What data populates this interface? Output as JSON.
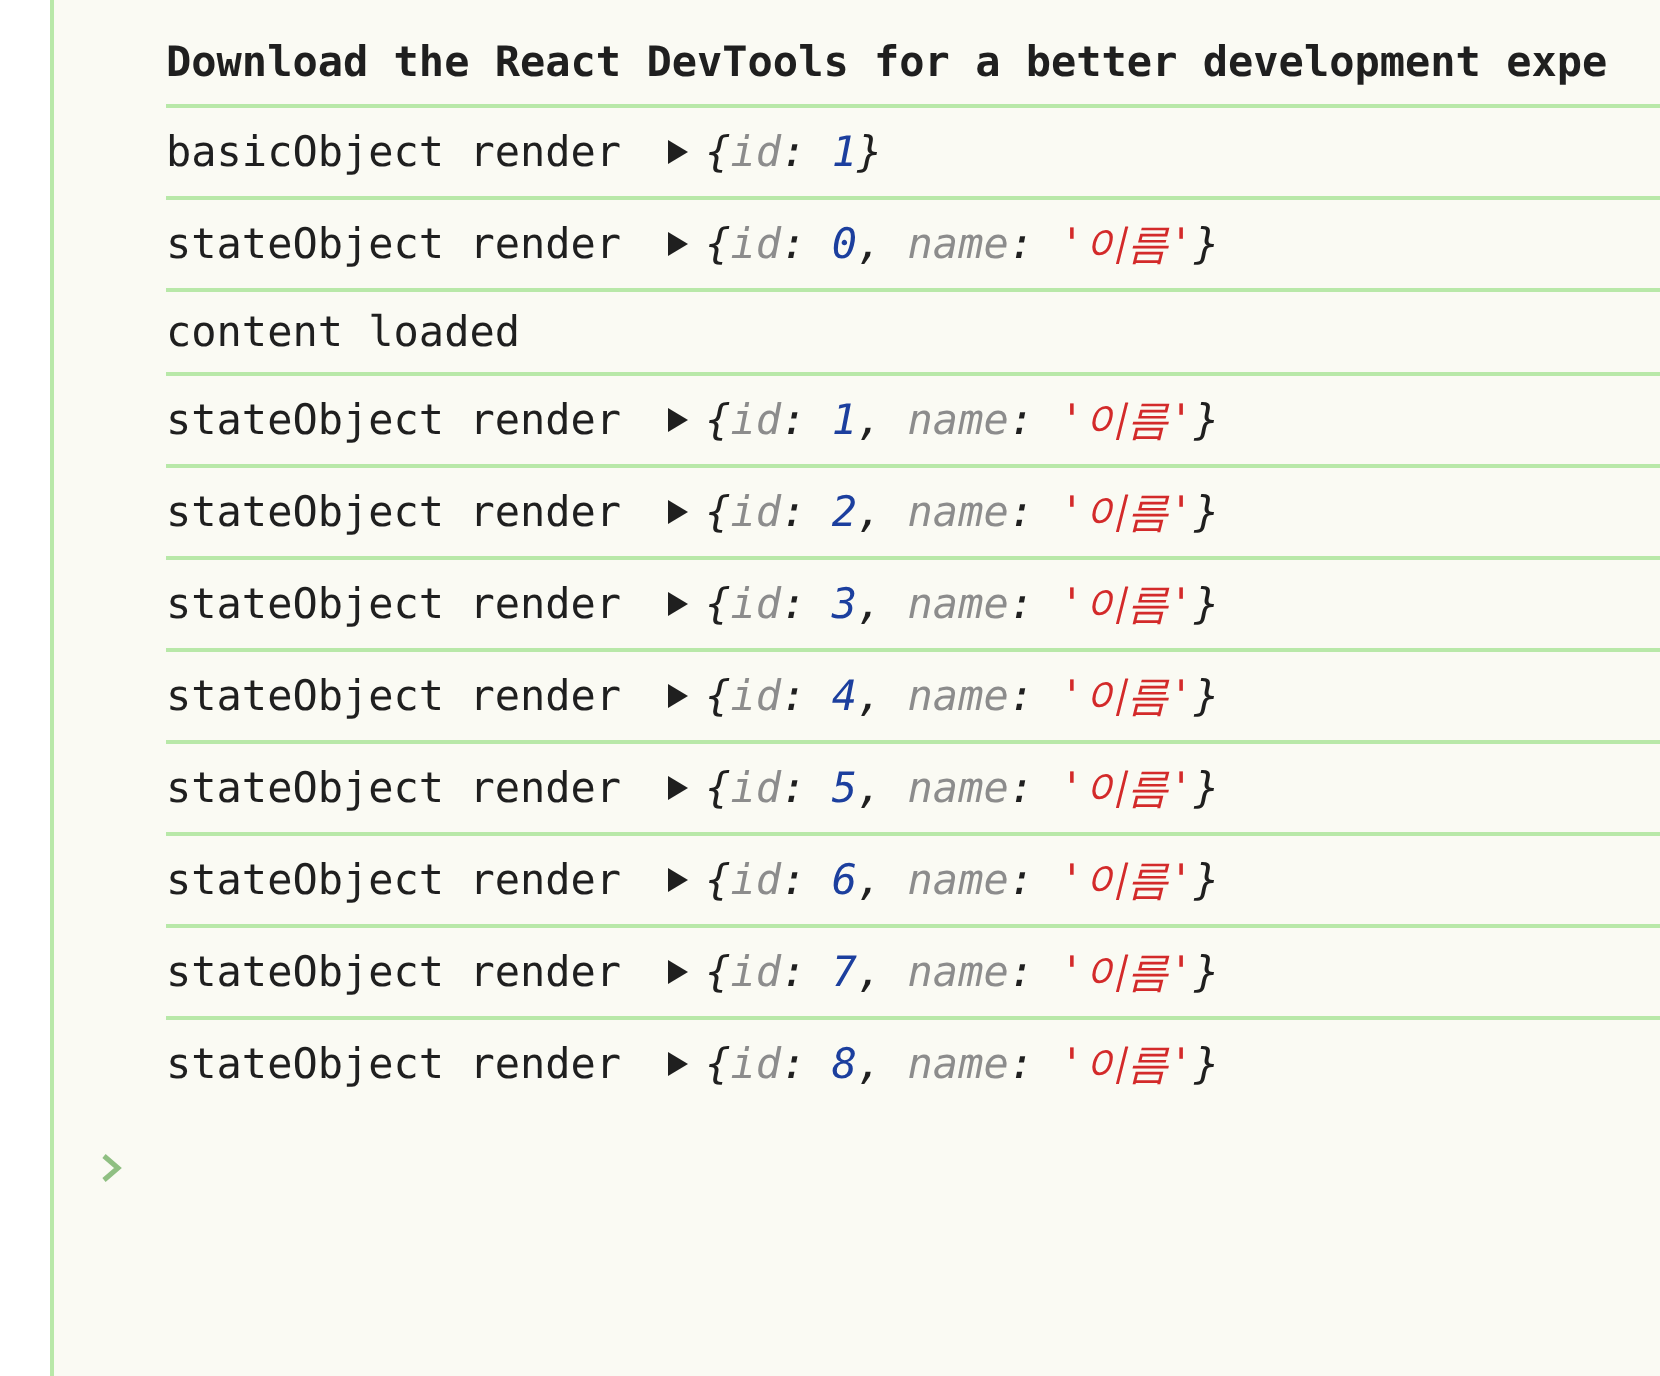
{
  "console": {
    "messages": [
      {
        "kind": "header",
        "text": "Download the React DevTools for a better development expe"
      },
      {
        "kind": "log",
        "text": "basicObject render",
        "object": {
          "expanded": false,
          "tokens": [
            {
              "kind": "punct",
              "text": "{"
            },
            {
              "kind": "key",
              "text": "id"
            },
            {
              "kind": "punct",
              "text": ": "
            },
            {
              "kind": "number",
              "text": "1"
            },
            {
              "kind": "punct",
              "text": "}"
            }
          ]
        }
      },
      {
        "kind": "log",
        "text": "stateObject render",
        "object": {
          "expanded": false,
          "tokens": [
            {
              "kind": "punct",
              "text": "{"
            },
            {
              "kind": "key",
              "text": "id"
            },
            {
              "kind": "punct",
              "text": ": "
            },
            {
              "kind": "number",
              "text": "0"
            },
            {
              "kind": "punct",
              "text": ", "
            },
            {
              "kind": "key",
              "text": "name"
            },
            {
              "kind": "punct",
              "text": ": "
            },
            {
              "kind": "string",
              "text": "'이름'"
            },
            {
              "kind": "punct",
              "text": "}"
            }
          ]
        }
      },
      {
        "kind": "text",
        "text": "content loaded"
      },
      {
        "kind": "log",
        "text": "stateObject render",
        "object": {
          "expanded": false,
          "tokens": [
            {
              "kind": "punct",
              "text": "{"
            },
            {
              "kind": "key",
              "text": "id"
            },
            {
              "kind": "punct",
              "text": ": "
            },
            {
              "kind": "number",
              "text": "1"
            },
            {
              "kind": "punct",
              "text": ", "
            },
            {
              "kind": "key",
              "text": "name"
            },
            {
              "kind": "punct",
              "text": ": "
            },
            {
              "kind": "string",
              "text": "'이름'"
            },
            {
              "kind": "punct",
              "text": "}"
            }
          ]
        }
      },
      {
        "kind": "log",
        "text": "stateObject render",
        "object": {
          "expanded": false,
          "tokens": [
            {
              "kind": "punct",
              "text": "{"
            },
            {
              "kind": "key",
              "text": "id"
            },
            {
              "kind": "punct",
              "text": ": "
            },
            {
              "kind": "number",
              "text": "2"
            },
            {
              "kind": "punct",
              "text": ", "
            },
            {
              "kind": "key",
              "text": "name"
            },
            {
              "kind": "punct",
              "text": ": "
            },
            {
              "kind": "string",
              "text": "'이름'"
            },
            {
              "kind": "punct",
              "text": "}"
            }
          ]
        }
      },
      {
        "kind": "log",
        "text": "stateObject render",
        "object": {
          "expanded": false,
          "tokens": [
            {
              "kind": "punct",
              "text": "{"
            },
            {
              "kind": "key",
              "text": "id"
            },
            {
              "kind": "punct",
              "text": ": "
            },
            {
              "kind": "number",
              "text": "3"
            },
            {
              "kind": "punct",
              "text": ", "
            },
            {
              "kind": "key",
              "text": "name"
            },
            {
              "kind": "punct",
              "text": ": "
            },
            {
              "kind": "string",
              "text": "'이름'"
            },
            {
              "kind": "punct",
              "text": "}"
            }
          ]
        }
      },
      {
        "kind": "log",
        "text": "stateObject render",
        "object": {
          "expanded": false,
          "tokens": [
            {
              "kind": "punct",
              "text": "{"
            },
            {
              "kind": "key",
              "text": "id"
            },
            {
              "kind": "punct",
              "text": ": "
            },
            {
              "kind": "number",
              "text": "4"
            },
            {
              "kind": "punct",
              "text": ", "
            },
            {
              "kind": "key",
              "text": "name"
            },
            {
              "kind": "punct",
              "text": ": "
            },
            {
              "kind": "string",
              "text": "'이름'"
            },
            {
              "kind": "punct",
              "text": "}"
            }
          ]
        }
      },
      {
        "kind": "log",
        "text": "stateObject render",
        "object": {
          "expanded": false,
          "tokens": [
            {
              "kind": "punct",
              "text": "{"
            },
            {
              "kind": "key",
              "text": "id"
            },
            {
              "kind": "punct",
              "text": ": "
            },
            {
              "kind": "number",
              "text": "5"
            },
            {
              "kind": "punct",
              "text": ", "
            },
            {
              "kind": "key",
              "text": "name"
            },
            {
              "kind": "punct",
              "text": ": "
            },
            {
              "kind": "string",
              "text": "'이름'"
            },
            {
              "kind": "punct",
              "text": "}"
            }
          ]
        }
      },
      {
        "kind": "log",
        "text": "stateObject render",
        "object": {
          "expanded": false,
          "tokens": [
            {
              "kind": "punct",
              "text": "{"
            },
            {
              "kind": "key",
              "text": "id"
            },
            {
              "kind": "punct",
              "text": ": "
            },
            {
              "kind": "number",
              "text": "6"
            },
            {
              "kind": "punct",
              "text": ", "
            },
            {
              "kind": "key",
              "text": "name"
            },
            {
              "kind": "punct",
              "text": ": "
            },
            {
              "kind": "string",
              "text": "'이름'"
            },
            {
              "kind": "punct",
              "text": "}"
            }
          ]
        }
      },
      {
        "kind": "log",
        "text": "stateObject render",
        "object": {
          "expanded": false,
          "tokens": [
            {
              "kind": "punct",
              "text": "{"
            },
            {
              "kind": "key",
              "text": "id"
            },
            {
              "kind": "punct",
              "text": ": "
            },
            {
              "kind": "number",
              "text": "7"
            },
            {
              "kind": "punct",
              "text": ", "
            },
            {
              "kind": "key",
              "text": "name"
            },
            {
              "kind": "punct",
              "text": ": "
            },
            {
              "kind": "string",
              "text": "'이름'"
            },
            {
              "kind": "punct",
              "text": "}"
            }
          ]
        }
      },
      {
        "kind": "log",
        "text": "stateObject render",
        "object": {
          "expanded": false,
          "tokens": [
            {
              "kind": "punct",
              "text": "{"
            },
            {
              "kind": "key",
              "text": "id"
            },
            {
              "kind": "punct",
              "text": ": "
            },
            {
              "kind": "number",
              "text": "8"
            },
            {
              "kind": "punct",
              "text": ", "
            },
            {
              "kind": "key",
              "text": "name"
            },
            {
              "kind": "punct",
              "text": ": "
            },
            {
              "kind": "string",
              "text": "'이름'"
            },
            {
              "kind": "punct",
              "text": "}"
            }
          ]
        }
      }
    ]
  }
}
